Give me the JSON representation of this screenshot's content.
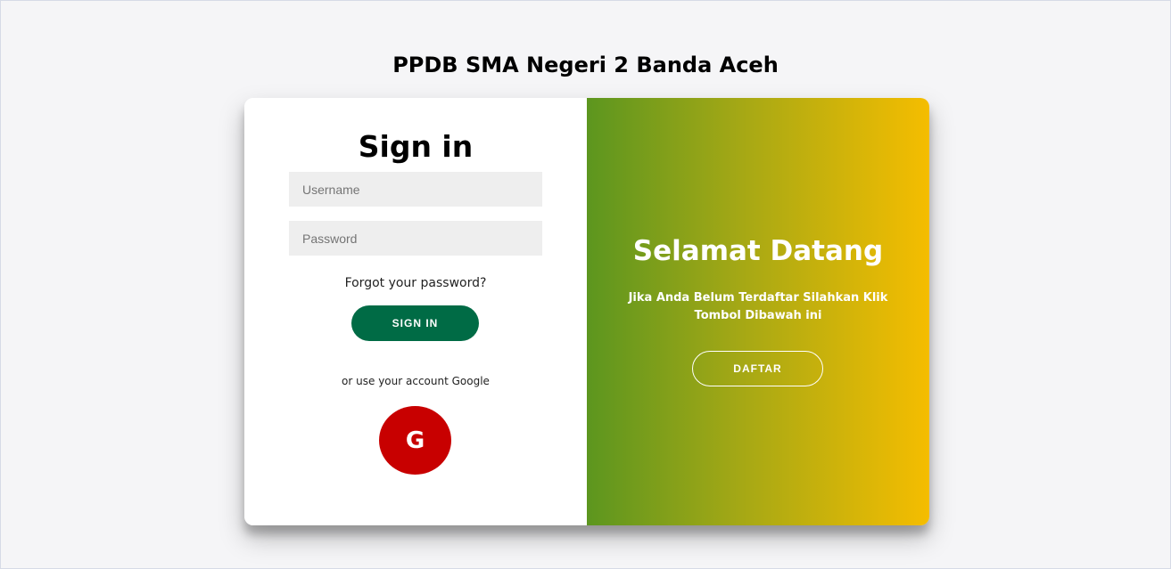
{
  "page": {
    "title": "PPDB SMA Negeri 2 Banda Aceh"
  },
  "signin": {
    "heading": "Sign in",
    "username_placeholder": "Username",
    "password_placeholder": "Password",
    "forgot_label": "Forgot your password?",
    "button_label": "SIGN IN",
    "alt_text": "or use your account Google",
    "google_letter": "G"
  },
  "welcome": {
    "heading": "Selamat Datang",
    "text": "Jika Anda Belum Terdaftar Silahkan Klik Tombol Dibawah ini",
    "button_label": "DAFTAR"
  },
  "colors": {
    "signin_button": "#006b45",
    "google_button": "#c80000",
    "gradient_start": "#5c961f",
    "gradient_end": "#f5bd00",
    "background": "#f5f5f7"
  },
  "icons": {
    "google": "google-icon"
  }
}
